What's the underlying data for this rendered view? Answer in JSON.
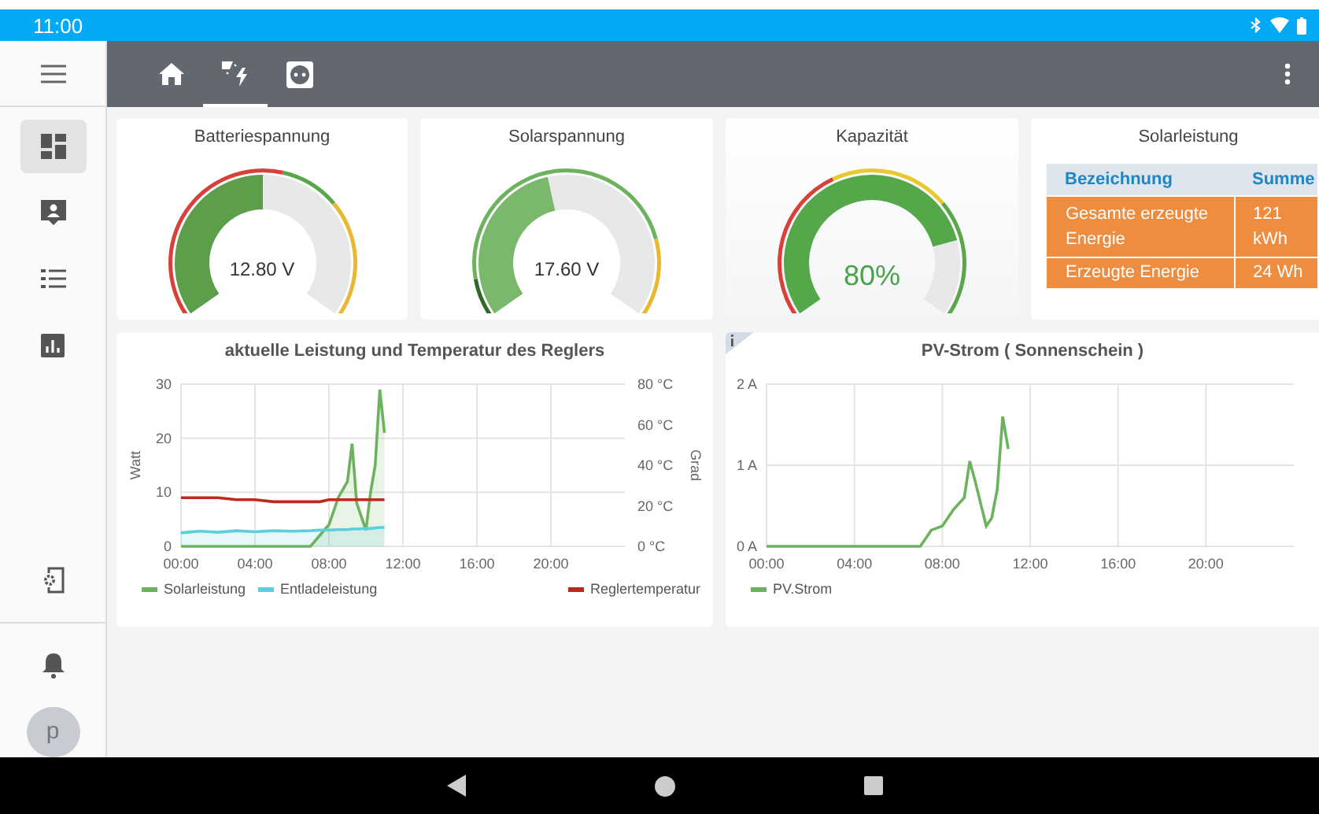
{
  "status_bar": {
    "time": "11:00"
  },
  "sidebar": {
    "items": [
      {
        "selected": true
      },
      {
        "selected": false
      },
      {
        "selected": false
      },
      {
        "selected": false
      }
    ],
    "avatar": "p"
  },
  "tabs": [
    {
      "selected": false
    },
    {
      "selected": true
    },
    {
      "selected": false
    }
  ],
  "gauges": [
    {
      "title": "Batteriespannung",
      "reading": "12.80 V"
    },
    {
      "title": "Solarspannung",
      "reading": "17.60 V"
    },
    {
      "title": "Kapazität",
      "reading": "80%"
    }
  ],
  "table": {
    "title": "Solarleistung",
    "columns": [
      "Bezeichnung",
      "Summe"
    ],
    "rows": [
      [
        "Gesamte erzeugte Energie",
        "121 kWh"
      ],
      [
        "Erzeugte Energie",
        "24 Wh"
      ]
    ]
  },
  "charts": [
    {
      "info": false,
      "chart_data": {
        "type": "area",
        "grid": true,
        "title": "aktuelle Leistung und Temperatur des Reglers",
        "ylabel": "Watt",
        "y2label": "Grad",
        "x": [
          0,
          1,
          2,
          3,
          4,
          5,
          6,
          7,
          7.5,
          8,
          8.5,
          9,
          9.25,
          9.5,
          10,
          10.25,
          10.5,
          10.75,
          11
        ],
        "xlim": [
          0,
          24
        ],
        "ylim": [
          0,
          30
        ],
        "y2lim": [
          0,
          80
        ],
        "xticks": [
          {
            "value": 0,
            "label": "00:00"
          },
          {
            "value": 4,
            "label": "04:00"
          },
          {
            "value": 8,
            "label": "08:00"
          },
          {
            "value": 12,
            "label": "12:00"
          },
          {
            "value": 16,
            "label": "16:00"
          },
          {
            "value": 20,
            "label": "20:00"
          }
        ],
        "yticks": [
          0,
          10,
          20,
          30
        ],
        "y2ticks": [
          {
            "value": 0,
            "label": "0 °C"
          },
          {
            "value": 20,
            "label": "20 °C"
          },
          {
            "value": 40,
            "label": "40 °C"
          },
          {
            "value": 60,
            "label": "60 °C"
          },
          {
            "value": 80,
            "label": "80 °C"
          }
        ],
        "series": [
          {
            "name": "Solarleistung",
            "color": "#6db35f",
            "values": [
              0,
              0,
              0,
              0,
              0,
              0,
              0,
              0,
              2,
              4,
              9,
              12,
              19,
              8,
              3,
              10,
              15,
              29,
              21
            ]
          },
          {
            "name": "Entladeleistung",
            "color": "#5bd0dc",
            "values": [
              2.5,
              2.8,
              2.6,
              2.9,
              2.7,
              2.9,
              2.8,
              2.9,
              3,
              3,
              3.1,
              3.1,
              3.2,
              3.2,
              3.3,
              3.3,
              3.4,
              3.5,
              3.5
            ]
          },
          {
            "name": "Reglertemperatur",
            "color": "#c0281c",
            "axis": "y2",
            "type": "line",
            "values": [
              24,
              24,
              24,
              23,
              23,
              22,
              22,
              22,
              22,
              23,
              23,
              23,
              23,
              23,
              23,
              23,
              23,
              23,
              23
            ]
          }
        ]
      }
    },
    {
      "info": true,
      "chart_data": {
        "type": "line",
        "grid": true,
        "title": "PV-Strom ( Sonnenschein )",
        "x": [
          0,
          1,
          2,
          3,
          4,
          5,
          6,
          7,
          7.5,
          8,
          8.5,
          9,
          9.25,
          9.5,
          10,
          10.25,
          10.5,
          10.75,
          11
        ],
        "xlim": [
          0,
          24
        ],
        "ylim": [
          0,
          2
        ],
        "xticks": [
          {
            "value": 0,
            "label": "00:00"
          },
          {
            "value": 4,
            "label": "04:00"
          },
          {
            "value": 8,
            "label": "08:00"
          },
          {
            "value": 12,
            "label": "12:00"
          },
          {
            "value": 16,
            "label": "16:00"
          },
          {
            "value": 20,
            "label": "20:00"
          }
        ],
        "yticks": [
          {
            "value": 0,
            "label": "0 A"
          },
          {
            "value": 1,
            "label": "1 A"
          },
          {
            "value": 2,
            "label": "2 A"
          }
        ],
        "series": [
          {
            "name": "PV.Strom",
            "color": "#6db35f",
            "values": [
              0,
              0,
              0,
              0,
              0,
              0,
              0,
              0,
              0.2,
              0.25,
              0.45,
              0.6,
              1.05,
              0.8,
              0.25,
              0.35,
              0.7,
              1.6,
              1.2
            ]
          }
        ]
      }
    }
  ]
}
